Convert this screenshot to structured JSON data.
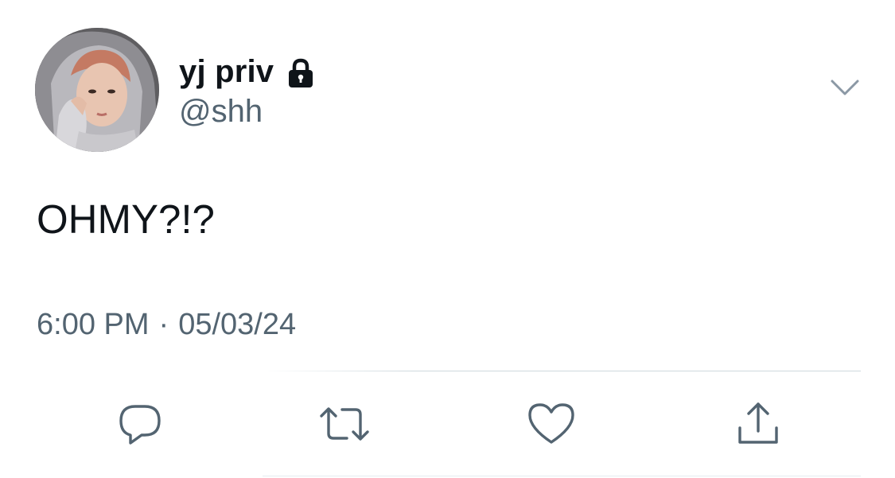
{
  "tweet": {
    "display_name": "yj priv",
    "handle": "@shh",
    "protected": true,
    "text": "OHMY?!?",
    "time": "6:00 PM",
    "separator": "·",
    "date": "05/03/24"
  },
  "icons": {
    "lock": "lock-icon",
    "menu": "chevron-down-icon",
    "reply": "reply-icon",
    "retweet": "retweet-icon",
    "like": "heart-icon",
    "share": "share-icon"
  },
  "colors": {
    "text_primary": "#0f1419",
    "text_secondary": "#536471",
    "icon": "#536471",
    "divider": "#cfd9de",
    "background": "#ffffff"
  }
}
